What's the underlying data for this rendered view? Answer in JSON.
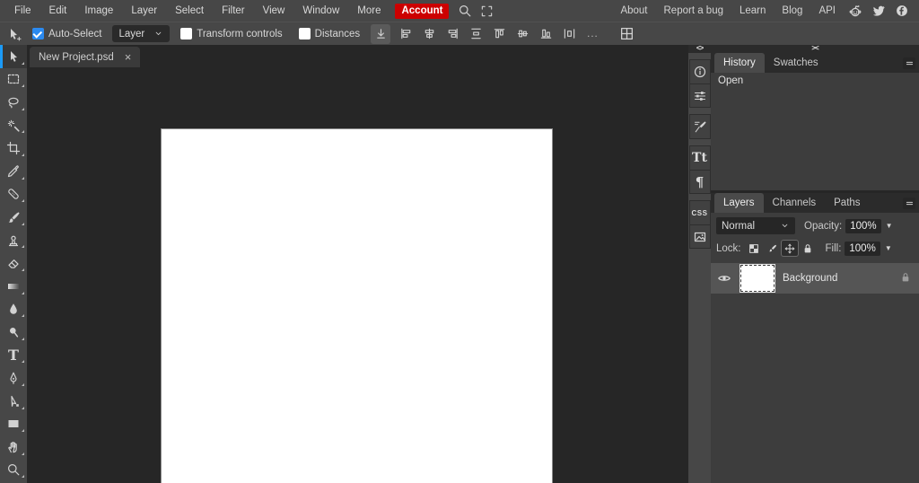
{
  "menubar": {
    "items": [
      "File",
      "Edit",
      "Image",
      "Layer",
      "Select",
      "Filter",
      "View",
      "Window",
      "More"
    ],
    "account_label": "Account",
    "links": [
      "About",
      "Report a bug",
      "Learn",
      "Blog",
      "API"
    ],
    "social_icons": [
      "reddit-icon",
      "twitter-icon",
      "facebook-icon"
    ]
  },
  "optionsbar": {
    "tool_icon": "move-cursor-icon",
    "checkboxes": [
      {
        "label": "Auto-Select",
        "checked": true
      },
      {
        "label": "Transform controls",
        "checked": false
      },
      {
        "label": "Distances",
        "checked": false
      }
    ],
    "target_dropdown": {
      "value": "Layer"
    },
    "align_icons": [
      "align-left",
      "align-center-h",
      "align-right",
      "distribute-v",
      "align-top",
      "align-middle",
      "align-bottom",
      "distribute-h"
    ],
    "more_dots": "...",
    "grid_icon": "grid-icon"
  },
  "tabs": [
    {
      "title": "New Project.psd",
      "close_glyph": "×",
      "active": true
    }
  ],
  "toolbox": {
    "selected": "move",
    "tools": [
      {
        "name": "move"
      },
      {
        "name": "marquee-select"
      },
      {
        "name": "lasso"
      },
      {
        "name": "magic-wand"
      },
      {
        "name": "crop"
      },
      {
        "name": "eyedropper"
      },
      {
        "name": "spot-heal"
      },
      {
        "name": "brush"
      },
      {
        "name": "clone-stamp"
      },
      {
        "name": "eraser"
      },
      {
        "name": "gradient"
      },
      {
        "name": "blur"
      },
      {
        "name": "dodge"
      },
      {
        "name": "type",
        "glyph": "T"
      },
      {
        "name": "pen"
      },
      {
        "name": "path-select"
      },
      {
        "name": "rectangle-shape"
      },
      {
        "name": "hand"
      },
      {
        "name": "zoom"
      }
    ]
  },
  "dock": {
    "collapse_glyph": "<>",
    "groups": [
      [
        {
          "name": "info"
        },
        {
          "name": "adjustments"
        }
      ],
      [
        {
          "name": "brush-settings"
        }
      ],
      [
        {
          "name": "character",
          "glyph": "Tt"
        },
        {
          "name": "paragraph",
          "glyph": "¶"
        }
      ],
      [
        {
          "name": "css",
          "glyph": "CSS"
        },
        {
          "name": "image"
        }
      ]
    ]
  },
  "panels": {
    "collapse_glyph": "><",
    "history": {
      "tabs": [
        {
          "label": "History",
          "active": true
        },
        {
          "label": "Swatches",
          "active": false
        }
      ],
      "items": [
        "Open"
      ]
    },
    "layers": {
      "tabs": [
        {
          "label": "Layers",
          "active": true
        },
        {
          "label": "Channels",
          "active": false
        },
        {
          "label": "Paths",
          "active": false
        }
      ],
      "blend_mode": "Normal",
      "opacity_label": "Opacity:",
      "opacity_value": "100%",
      "lock_label": "Lock:",
      "lock_icons": [
        "lock-transparency",
        "lock-pixels",
        "lock-position",
        "lock-all"
      ],
      "lock_active": "lock-position",
      "fill_label": "Fill:",
      "fill_value": "100%",
      "rows": [
        {
          "name": "Background",
          "visible": true,
          "locked": true,
          "selected": true
        }
      ]
    }
  },
  "colors": {
    "accent_blue": "#2b8af0",
    "account_red": "#cc0000",
    "chrome": "#474747",
    "workspace": "#262626",
    "panel": "#3d3d3d",
    "selected_row": "#555555"
  }
}
